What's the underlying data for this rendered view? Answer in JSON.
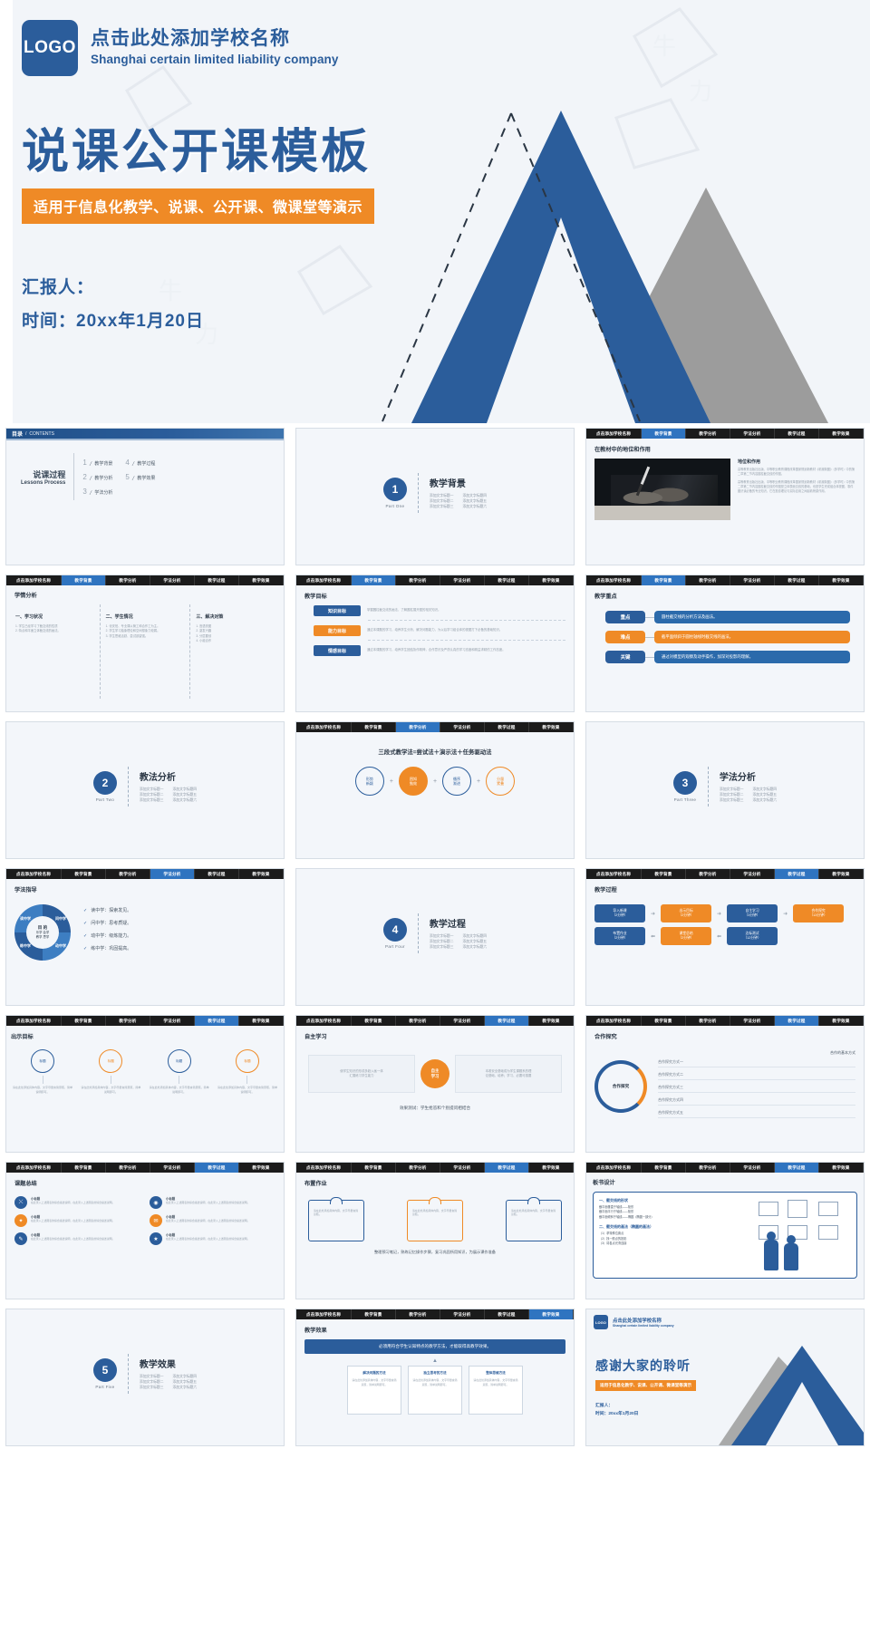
{
  "hero": {
    "logo": "LOGO",
    "school_name_cn": "点击此处添加学校名称",
    "school_name_en": "Shanghai certain limited liability company",
    "title": "说课公开课模板",
    "subtitle": "适用于信息化教学、说课、公开课、微课堂等演示",
    "presenter_label": "汇报人：",
    "date_label": "时间：20xx年1月20日",
    "accent_blue": "#2b5d9b",
    "accent_orange": "#ef8a26",
    "background": "#f2f5f9"
  },
  "nav_tabs": [
    {
      "label": "点击添加学校名称",
      "active": false
    },
    {
      "label": "教学背景",
      "active": false
    },
    {
      "label": "教学分析",
      "active": false
    },
    {
      "label": "学法分析",
      "active": false
    },
    {
      "label": "教学过程",
      "active": false
    },
    {
      "label": "教学效果",
      "active": false
    }
  ],
  "toc": {
    "bar_cn": "目录",
    "bar_sep": "/",
    "bar_en": "CONTENTS",
    "heading_cn": "说课过程",
    "heading_en": "Lessons Process",
    "items": [
      {
        "num": "1",
        "label": "教学背景"
      },
      {
        "num": "4",
        "label": "教学过程"
      },
      {
        "num": "2",
        "label": "教学分析"
      },
      {
        "num": "5",
        "label": "教学效果"
      },
      {
        "num": "3",
        "label": "学法分析"
      }
    ]
  },
  "sections": [
    {
      "num": "1",
      "part": "Part One",
      "title": "教学背景",
      "bullets": [
        "添加文字标题一",
        "添加文字标题四",
        "添加文字标题二",
        "添加文字标题五",
        "添加文字标题三",
        "添加文字标题六"
      ]
    },
    {
      "num": "2",
      "part": "Part Two",
      "title": "教法分析",
      "bullets": [
        "添加文字标题一",
        "添加文字标题四",
        "添加文字标题二",
        "添加文字标题五",
        "添加文字标题三",
        "添加文字标题六"
      ]
    },
    {
      "num": "3",
      "part": "Part Three",
      "title": "学法分析",
      "bullets": [
        "添加文字标题一",
        "添加文字标题四",
        "添加文字标题二",
        "添加文字标题五",
        "添加文字标题三",
        "添加文字标题六"
      ]
    },
    {
      "num": "4",
      "part": "Part Four",
      "title": "教学过程",
      "bullets": [
        "添加文字标题一",
        "添加文字标题四",
        "添加文字标题二",
        "添加文字标题五",
        "添加文字标题三",
        "添加文字标题六"
      ]
    },
    {
      "num": "5",
      "part": "Part Five",
      "title": "教学效果",
      "bullets": [
        "添加文字标题一",
        "添加文字标题四",
        "添加文字标题二",
        "添加文字标题五",
        "添加文字标题三",
        "添加文字标题六"
      ]
    }
  ],
  "slide_status": {
    "title": "在教材中的地位和作用",
    "image_name": "hand-writing-photo",
    "side_title": "地位和作用",
    "side_text_1": "高等教育出版社出版、中等职业教育课程改革国家规划新教材《机械制图》（多学时）中的第二章第二节内容圆柱截交线的作图。",
    "side_text_2": "高等教育出版社出版、中等职业教育课程改革国家规划新教材《机械制图》（多学时）中的第二章第二节内容圆柱截交线的作图是立体表面交线的基础，也是学生完成组合体视图、零件图识读必备的专业知识，它在投影理论与实际应用之间起着桥梁作用。"
  },
  "slide_xueqing": {
    "title": "学情分析",
    "columns": [
      {
        "h": "一、学习状况",
        "p": "1. 学生已经学习了截交线的性质\n2. 特点和平面立体截交线的画法。"
      },
      {
        "h": "二、学生情况",
        "p": "1. 化安班、专业课以管工和合作工为主。\n2. 学生学习抽象理论和空间想象力较弱。\n3. 学生思维活跃、尝试欲望强。"
      },
      {
        "h": "三、解决对策",
        "p": "1. 宫语亮图\n2. 激发兴趣\n3. 分层要领\n4. 小组合作"
      }
    ]
  },
  "slide_goals": {
    "title": "教学目标",
    "rows": [
      {
        "chip": "知识目标",
        "color": "blue",
        "text": "掌握圆柱截交线的画法，了解圆柱展开图的相关知识。"
      },
      {
        "chip": "能力目标",
        "color": "orange",
        "text": "通过本课题的学习，培养学生分析、解决问题能力，为以后学习组合体的视图打下必备的基础知识。"
      },
      {
        "chip": "情感目标",
        "color": "blue",
        "text": "通过本课题的学习，培养学生团结协作精神，合作意识及严谨认真的学习态度和精益求精的工作态度。"
      }
    ]
  },
  "slide_keypoints": {
    "title": "教学重点",
    "rows": [
      {
        "chip": "重点",
        "color": "blue",
        "text": "圆柱截交线的分析方法及画法。"
      },
      {
        "chip": "难点",
        "color": "orange",
        "text": "截平面倾斜于圆柱轴线时截交线的画法。"
      },
      {
        "chip": "关键",
        "color": "blue",
        "text": "通过对模型的观察及动手操作，加深对投影的理解。"
      }
    ]
  },
  "slide_method": {
    "title": "教法分析",
    "headline": "三段式教学法=尝试法＋演示法＋任务驱动法",
    "steps": [
      "形势\n新颖",
      "困知\n勉效",
      "循序\n渐进",
      "分量\n累叠"
    ],
    "plus": "+"
  },
  "slide_xuefa": {
    "title": "学法指导",
    "donut_center": "目 的",
    "donut_center_sub": "乐学 会学\n教学 思学",
    "donut_labels": [
      "读中学",
      "问中学",
      "练中学",
      "动中学"
    ],
    "list": [
      "读中学：探索发见。",
      "问中学：思考质疑。",
      "动中学：级炼能力。",
      "练中学：巩固提高。"
    ]
  },
  "slide_process": {
    "title": "教学过程",
    "boxes": [
      {
        "label": "导入新课",
        "time": "（2分钟）",
        "color": "blue"
      },
      {
        "label": "出示目标",
        "time": "（2分钟）",
        "color": "orange"
      },
      {
        "label": "自主学习",
        "time": "（3分钟）",
        "color": "blue"
      },
      {
        "label": "合作探究",
        "time": "（13分钟）",
        "color": "orange"
      },
      {
        "label": "布置作业",
        "time": "（2分钟）",
        "color": "blue"
      },
      {
        "label": "课堂总结",
        "time": "（2分钟）",
        "color": "orange"
      },
      {
        "label": "达标测试",
        "time": "（12分钟）",
        "color": "blue"
      }
    ]
  },
  "slide_targets": {
    "title": "出示目标",
    "items": [
      {
        "label": "标题",
        "color": "blue",
        "text": "请在此处添加具体内容，文字尽量言简意赅，简单说明即可。"
      },
      {
        "label": "标题",
        "color": "orange",
        "text": "请在此处添加具体内容，文字尽量言简意赅，简单说明即可。"
      },
      {
        "label": "标题",
        "color": "blue",
        "text": "请在此处添加具体内容，文字尽量言简意赅，简单说明即可。"
      },
      {
        "label": "标题",
        "color": "orange",
        "text": "请在此处添加具体内容，文字尽量言简意赅，简单说明即可。"
      }
    ]
  },
  "slide_self": {
    "title": "自主学习",
    "left_text": "使学生知识的形成多趋入画一体\n汇展练习学生能力",
    "center": "自主\n学习",
    "right_text": "本着安全基础成为学生课题系的理\n论基础，培养；学习、必要可感要",
    "bottom_note": "效果测试：学生抢答和个别提问相结合"
  },
  "slide_coop": {
    "title": "合作探究",
    "ring_label": "合作探究",
    "list_heading": "合作的基本方式",
    "items": [
      "合作探究方式一",
      "合作探究方式二",
      "合作探究方式三",
      "合作探究方式四",
      "合作探究方式五"
    ]
  },
  "slide_summary": {
    "title": "课题总结",
    "items": [
      {
        "icon": "share-icon",
        "color": "blue",
        "head": "小标题",
        "text": "在此录入上述图表的综合描述说明，在此录入上述图表的综合描述说明。"
      },
      {
        "icon": "pin-icon",
        "color": "blue",
        "head": "小标题",
        "text": "在此录入上述图表的综合描述说明，在此录入上述图表的综合描述说明。"
      },
      {
        "icon": "idea-icon",
        "color": "orange",
        "head": "小标题",
        "text": "在此录入上述图表的综合描述说明，在此录入上述图表的综合描述说明。"
      },
      {
        "icon": "mail-icon",
        "color": "orange",
        "head": "小标题",
        "text": "在此录入上述图表的综合描述说明，在此录入上述图表的综合描述说明。"
      },
      {
        "icon": "chat-icon",
        "color": "blue",
        "head": "小标题",
        "text": "在此录入上述图表的综合描述说明，在此录入上述图表的综合描述说明。"
      },
      {
        "icon": "star-icon",
        "color": "blue",
        "head": "小标题",
        "text": "在此录入上述图表的综合描述说明，在此录入上述图表的综合描述说明。"
      }
    ]
  },
  "slide_homework": {
    "title": "布置作业",
    "cards": [
      {
        "text": "请在此处添加具体内容，文字尽量言简意赅。",
        "color": "blue"
      },
      {
        "text": "请在此处添加具体内容，文字尽量言简意赅。",
        "color": "orange"
      },
      {
        "text": "请在此处添加具体内容，文字尽量言简意赅。",
        "color": "blue"
      }
    ],
    "note": "整理预习笔记，熟练记忆操作步骤，复习巩固所用知识，为展示课作准备"
  },
  "slide_board": {
    "title": "板书设计",
    "left": [
      {
        "h": "一、截交线的形状",
        "p": "截平面垂直于轴线——矩形\n截平面平行于轴线——矩形\n截平面倾斜于轴线——椭圆（椭圆一部分）"
      },
      {
        "h": "二、截交线的画法（椭圆的画法）",
        "p": "（1）求特殊位置点\n（2）找一般点的投影\n（3）将各点光滑连接"
      }
    ]
  },
  "slide_effect": {
    "title": "教学效果",
    "band": "必须用符合学生认知特点的教学方法，才能取得高教学效果。",
    "arrow": "▲",
    "cards": [
      {
        "head": "解决问题的方法",
        "text": "请在此处添加具体内容，文字尽量言简意赅，简单说明即可。"
      },
      {
        "head": "独立思考的方法",
        "text": "请在此处添加具体内容，文字尽量言简意赅，简单说明即可。"
      },
      {
        "head": "整体思维方法",
        "text": "请在此处添加具体内容，文字尽量言简意赅，简单说明即可。"
      }
    ]
  },
  "slide_thanks": {
    "logo": "LOGO",
    "brand_cn": "点击此处添加学校名称",
    "brand_en": "Shanghai certain limited liability company",
    "title": "感谢大家的聆听",
    "subtitle": "适用于信息化教学、说课、公开课、微课堂等演示",
    "presenter": "汇报人：",
    "date": "时间：20xx年1月20日"
  }
}
